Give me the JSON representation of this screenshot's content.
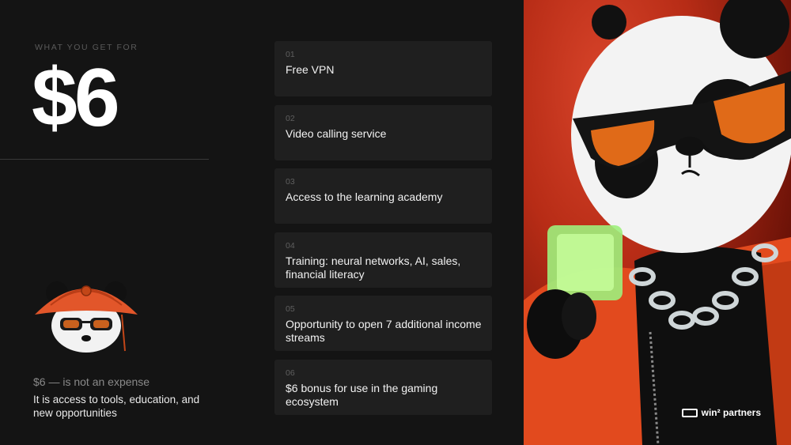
{
  "left": {
    "kicker": "WHAT YOU GET FOR",
    "price": "$6",
    "tag_muted": "$6 — is not an expense",
    "tag_text": "It is access to tools, education, and new opportunities"
  },
  "cards": [
    {
      "num": "01",
      "title": "Free VPN"
    },
    {
      "num": "02",
      "title": "Video calling service"
    },
    {
      "num": "03",
      "title": "Access to the learning academy"
    },
    {
      "num": "04",
      "title": "Training: neural networks, AI, sales, financial literacy"
    },
    {
      "num": "05",
      "title": "Opportunity to open 7 additional income streams"
    },
    {
      "num": "06",
      "title": "$6 bonus for use in the gaming ecosystem"
    }
  ],
  "brand": {
    "name": "win² partners"
  },
  "colors": {
    "background": "#141414",
    "card": "#1f1f1f",
    "accent": "#e2562a"
  }
}
